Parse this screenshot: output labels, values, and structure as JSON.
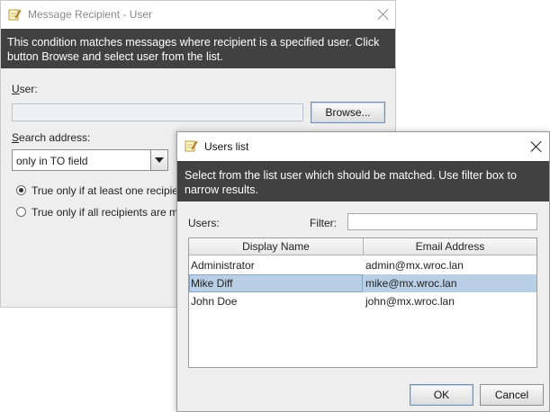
{
  "back_dialog": {
    "title": "Message Recipient - User",
    "description": "This condition matches messages where recipient is a specified user. Click button Browse and select user from the list.",
    "user_label": "User",
    "user_value": "",
    "browse_button": "Browse...",
    "search_address_label": "Search address",
    "search_address_selected": "only in TO field",
    "radio_options": [
      {
        "label": "True only if at least one recipie",
        "checked": true
      },
      {
        "label": "True only if all recipients are m",
        "checked": false
      }
    ]
  },
  "users_dialog": {
    "title": "Users list",
    "description": "Select from the list user which should be matched. Use filter box to narrow results.",
    "users_label": "Users:",
    "filter_label": "Filter:",
    "filter_value": "",
    "table": {
      "columns": [
        "Display Name",
        "Email Address"
      ],
      "rows": [
        {
          "name": "Administrator",
          "email": "admin@mx.wroc.lan",
          "selected": false
        },
        {
          "name": "Mike Diff",
          "email": "mike@mx.wroc.lan",
          "selected": true
        },
        {
          "name": "John Doe",
          "email": "john@mx.wroc.lan",
          "selected": false
        }
      ]
    },
    "ok_button": "OK",
    "cancel_button": "Cancel"
  },
  "colors": {
    "banner_bg": "#414141",
    "selection_bg": "#b8cfe5"
  },
  "icons": {
    "dialog_icon": "note-pencil-icon",
    "close": "close-icon",
    "dropdown": "chevron-down-icon"
  }
}
